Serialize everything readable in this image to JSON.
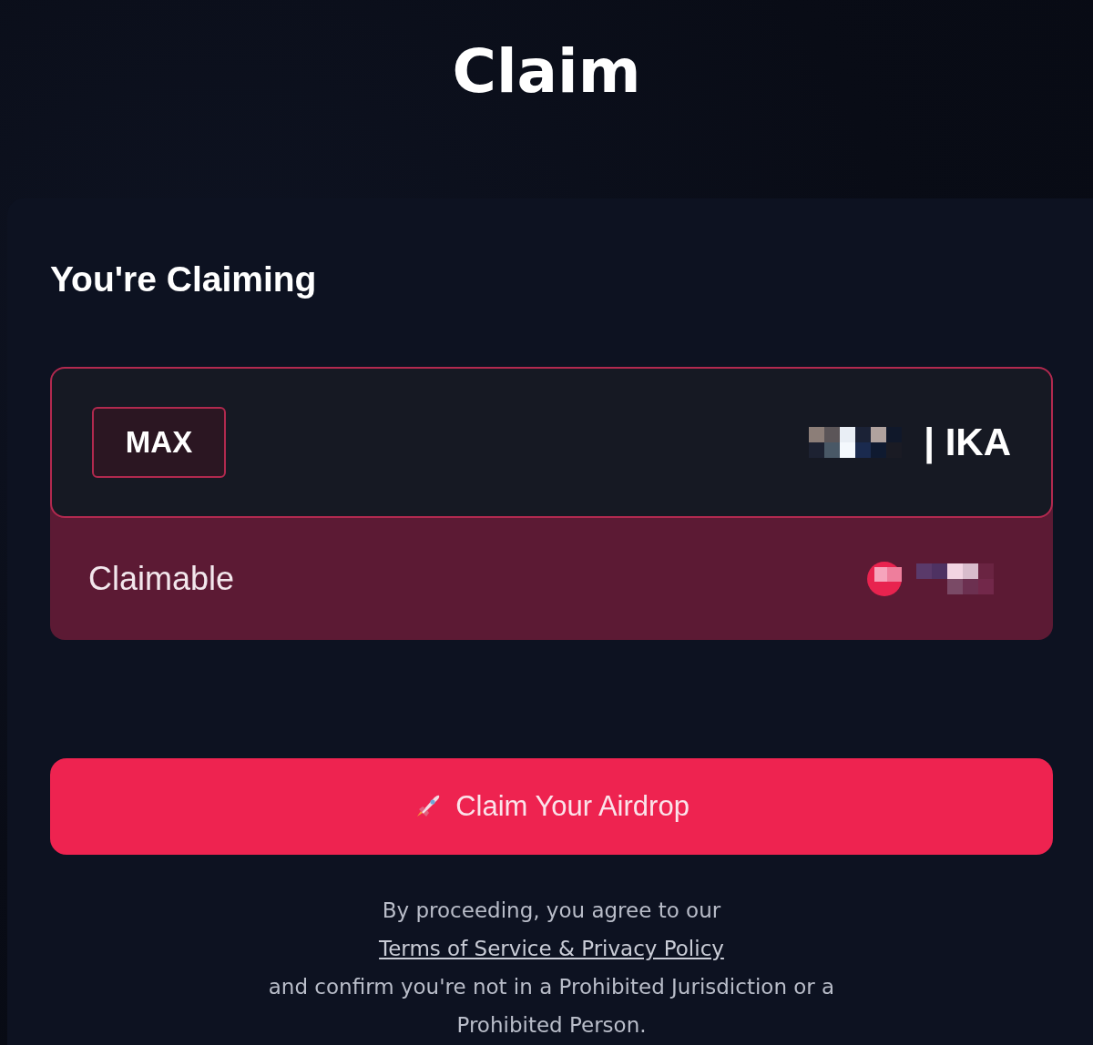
{
  "page": {
    "title": "Claim"
  },
  "card": {
    "heading": "You're Claiming",
    "amount_field": {
      "max_button": "MAX",
      "unit": "| IKA"
    },
    "claimable": {
      "label": "Claimable"
    },
    "claim_button": {
      "label": "Claim Your Airdrop"
    },
    "disclaimer": {
      "text": "By proceeding, you agree to our",
      "link": "Terms of Service & Privacy Policy",
      "text_2": "and confirm you're not in a Prohibited Jurisdiction or a Prohibited Person."
    }
  }
}
